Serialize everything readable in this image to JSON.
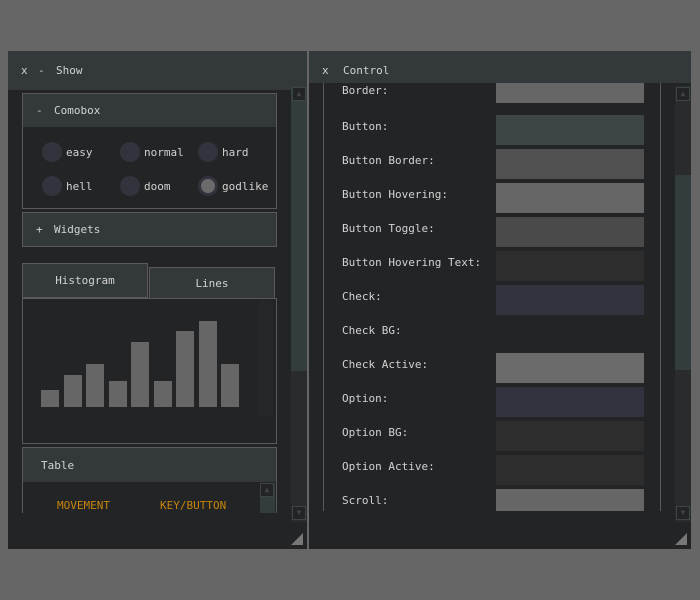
{
  "show_window": {
    "close": "x",
    "minimize": "-",
    "title": "Show",
    "combobox": {
      "toggle": "-",
      "title": "Comobox",
      "options": [
        "easy",
        "normal",
        "hard",
        "hell",
        "doom",
        "godlike"
      ],
      "selected": "godlike"
    },
    "widgets": {
      "toggle": "+",
      "title": "Widgets"
    },
    "tabs": [
      {
        "label": "Histogram",
        "active": true
      },
      {
        "label": "Lines",
        "active": false
      }
    ],
    "chart_data": {
      "type": "bar",
      "values": [
        18,
        34,
        45,
        27,
        68,
        27,
        80,
        91,
        45
      ]
    },
    "table": {
      "title": "Table",
      "columns": [
        "MOVEMENT",
        "KEY/BUTTON"
      ],
      "header_color": "#c8860b"
    }
  },
  "control_window": {
    "close": "x",
    "title": "Control",
    "rows": [
      {
        "label": "Border:",
        "color": "#666666"
      },
      {
        "label": "Button:",
        "color": "#3d4547"
      },
      {
        "label": "Button Border:",
        "color": "#505050"
      },
      {
        "label": "Button Hovering:",
        "color": "#666666"
      },
      {
        "label": "Button Toggle:",
        "color": "#4a4a4a"
      },
      {
        "label": "Button Hovering Text:",
        "color": "#2d2d2d"
      },
      {
        "label": "Check:",
        "color": "#33333d"
      },
      {
        "label": "Check BG:",
        "color": "#232426"
      },
      {
        "label": "Check Active:",
        "color": "#6b6b6b"
      },
      {
        "label": "Option:",
        "color": "#33333f"
      },
      {
        "label": "Option BG:",
        "color": "#2d2d2d"
      },
      {
        "label": "Option Active:",
        "color": "#2d2d2d"
      },
      {
        "label": "Scroll:",
        "color": "#666666"
      }
    ]
  },
  "icons": {
    "scroll_up": "triangle-up",
    "scroll_down": "triangle-down",
    "resize": "resize-grip"
  }
}
